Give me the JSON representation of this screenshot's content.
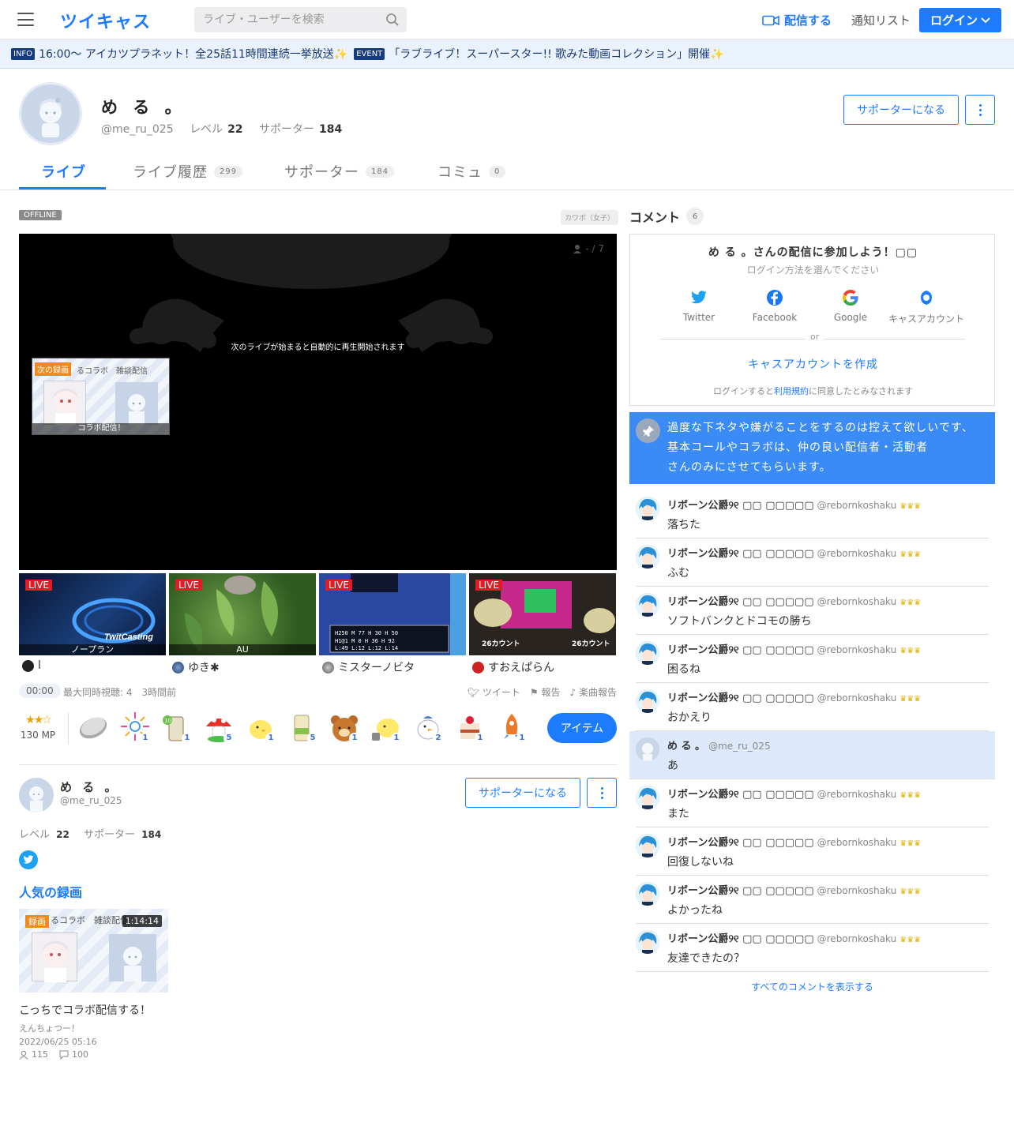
{
  "header": {
    "logo": "ツイキャス",
    "search_placeholder": "ライブ・ユーザーを検索",
    "broadcast": "配信する",
    "notifications": "通知リスト",
    "login": "ログイン"
  },
  "info_bar": {
    "info_tag": "INFO",
    "info_text": "16:00〜 アイカツプラネット！全25話11時間連続一挙放送✨",
    "event_tag": "EVENT",
    "event_text": "「ラブライブ！スーパースター!! 歌みた動画コレクション」開催✨"
  },
  "profile": {
    "name": "め る 。",
    "handle": "@me_ru_025",
    "level_label": "レベル",
    "level": "22",
    "supporter_label": "サポーター",
    "supporters": "184",
    "support_button": "サポーターになる"
  },
  "tabs": [
    {
      "label": "ライブ",
      "count": ""
    },
    {
      "label": "ライブ履歴",
      "count": "299"
    },
    {
      "label": "サポーター",
      "count": "184"
    },
    {
      "label": "コミュ",
      "count": "0"
    }
  ],
  "player": {
    "status": "OFFLINE",
    "category": "カワボ（女子）",
    "viewers": "- / 7",
    "next_message": "次のライブが始まると自動的に再生開始されます",
    "next_badge": "次の録画",
    "next_card_title": "るコラボ　雑談配信",
    "next_caption": "コラボ配信！"
  },
  "live_thumbs": [
    {
      "badge": "LIVE",
      "overlay": "ノープラン",
      "name": "l",
      "dot_color": "#222222"
    },
    {
      "badge": "LIVE",
      "overlay": "AU",
      "name": "ゆき✱",
      "dot_color": "#3a5a8a"
    },
    {
      "badge": "LIVE",
      "overlay": "",
      "name": "ミスターノビタ",
      "dot_color": "#777777"
    },
    {
      "badge": "LIVE",
      "overlay": "",
      "name": "すおえぱらん",
      "dot_color": "#cc2222"
    }
  ],
  "stats": {
    "time": "00:00",
    "summary": "最大同時視聴: 4　3時間前",
    "tweet": "ツイート",
    "report": "報告",
    "song_report": "楽曲報告"
  },
  "items": {
    "stars": "★★☆",
    "mp": "130 MP",
    "gifts": [
      {
        "icon": "coin-icon",
        "count": ""
      },
      {
        "icon": "fireworks-icon",
        "count": "1"
      },
      {
        "icon": "drink-icon",
        "count": "1"
      },
      {
        "icon": "mushroom-icon",
        "count": "5"
      },
      {
        "icon": "chick-icon",
        "count": "1"
      },
      {
        "icon": "cup-icon",
        "count": "5"
      },
      {
        "icon": "bear-icon",
        "count": "1"
      },
      {
        "icon": "chick2-icon",
        "count": "1"
      },
      {
        "icon": "bird-icon",
        "count": "2"
      },
      {
        "icon": "cake-icon",
        "count": "1"
      },
      {
        "icon": "rocket-icon",
        "count": "1"
      }
    ],
    "item_button": "アイテム"
  },
  "user_card": {
    "name": "め る 。",
    "handle": "@me_ru_025",
    "level_label": "レベル",
    "level": "22",
    "supporter_label": "サポーター",
    "supporters": "184",
    "support_button": "サポーターになる"
  },
  "popular": {
    "title": "人気の録画",
    "badge": "録画",
    "duration": "1:14:14",
    "card_title": "るコラボ　雑談配信",
    "video_title": "こっちでコラボ配信する！",
    "subtitle": "えんちょつー！",
    "date": "2022/06/25 05:16",
    "views": "115",
    "comments": "100"
  },
  "comments_panel": {
    "title": "コメント",
    "count": "6",
    "login_title": "め る 。さんの配信に参加しよう！▢▢",
    "login_sub": "ログイン方法を選んでください",
    "sns": [
      "Twitter",
      "Facebook",
      "Google",
      "キャスアカウント"
    ],
    "or": "or",
    "create": "キャスアカウントを作成",
    "terms_prefix": "ログインすると",
    "terms_link": "利用規約",
    "terms_suffix": "に同意したとみなされます",
    "pinned": [
      "過度な下ネタや嫌がることをするのは控えて欲しいです、",
      "基本コールやコラボは、仲の良い配信者・活動者",
      "さんのみにさせてもらいます。"
    ],
    "show_all": "すべてのコメントを表示する"
  },
  "comments": [
    {
      "name": "リボーン公爵୨୧ ▢▢ ▢▢▢▢▢",
      "handle": "@rebornkoshaku",
      "text": "落ちた",
      "me": false
    },
    {
      "name": "リボーン公爵୨୧ ▢▢ ▢▢▢▢▢",
      "handle": "@rebornkoshaku",
      "text": "ふむ",
      "me": false
    },
    {
      "name": "リボーン公爵୨୧ ▢▢ ▢▢▢▢▢",
      "handle": "@rebornkoshaku",
      "text": "ソフトバンクとドコモの勝ち",
      "me": false
    },
    {
      "name": "リボーン公爵୨୧ ▢▢ ▢▢▢▢▢",
      "handle": "@rebornkoshaku",
      "text": "困るね",
      "me": false
    },
    {
      "name": "リボーン公爵୨୧ ▢▢ ▢▢▢▢▢",
      "handle": "@rebornkoshaku",
      "text": "おかえり",
      "me": false
    },
    {
      "name": "め る 。",
      "handle": "@me_ru_025",
      "text": "あ",
      "me": true
    },
    {
      "name": "リボーン公爵୨୧ ▢▢ ▢▢▢▢▢",
      "handle": "@rebornkoshaku",
      "text": "また",
      "me": false
    },
    {
      "name": "リボーン公爵୨୧ ▢▢ ▢▢▢▢▢",
      "handle": "@rebornkoshaku",
      "text": "回復しないね",
      "me": false
    },
    {
      "name": "リボーン公爵୨୧ ▢▢ ▢▢▢▢▢",
      "handle": "@rebornkoshaku",
      "text": "よかったね",
      "me": false
    },
    {
      "name": "リボーン公爵୨୧ ▢▢ ▢▢▢▢▢",
      "handle": "@rebornkoshaku",
      "text": "友達できたの？",
      "me": false
    }
  ]
}
